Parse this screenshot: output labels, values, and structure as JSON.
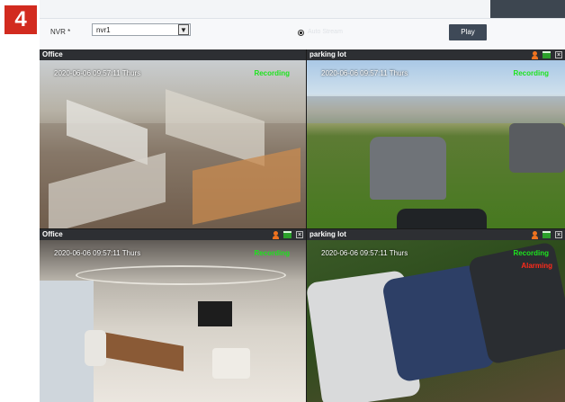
{
  "badge": "4",
  "toolbar": {
    "nvr_label": "NVR *",
    "nvr_value": "nvr1",
    "radio_label": "Auto Stream",
    "play_label": "Play"
  },
  "panes": [
    {
      "title": "Office",
      "timestamp": "2020-06-06 09:57:11 Thurs",
      "status": "Recording",
      "alarm": ""
    },
    {
      "title": "parking lot",
      "timestamp": "2020-06-06 09:57:11 Thurs",
      "status": "Recording",
      "alarm": ""
    },
    {
      "title": "Office",
      "timestamp": "2020-06-06 09:57:11 Thurs",
      "status": "Recording",
      "alarm": ""
    },
    {
      "title": "parking lot",
      "timestamp": "2020-06-06 09:57:11 Thurs",
      "status": "Recording",
      "alarm": "Alarming"
    }
  ],
  "colors": {
    "badge": "#d22b1f",
    "recording": "#1ee31e",
    "alarm": "#ff2a1a",
    "header": "#2d2f33",
    "play": "#3e4957"
  },
  "icons": [
    "person-alert-icon",
    "window-icon",
    "close-icon"
  ]
}
